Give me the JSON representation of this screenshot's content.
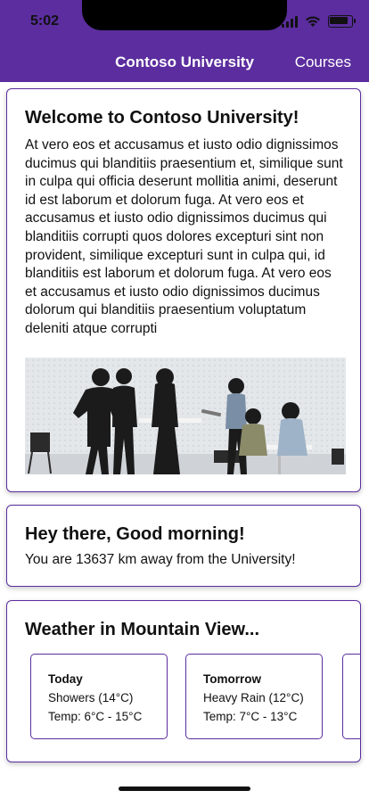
{
  "status_bar": {
    "time": "5:02"
  },
  "nav": {
    "title": "Contoso University",
    "link": "Courses"
  },
  "welcome": {
    "title": "Welcome to Contoso University!",
    "text": "At vero eos et accusamus et iusto odio dignissimos ducimus qui blanditiis praesentium et, similique sunt in culpa qui officia deserunt mollitia animi, deserunt id est laborum et dolorum fuga. At vero eos et accusamus et iusto odio dignissimos ducimus qui blanditiis corrupti quos dolores excepturi sint non provident, similique excepturi sunt in culpa qui, id blanditiis est laborum et dolorum fuga. At vero eos et accusamus et iusto odio dignissimos ducimus dolorum qui blanditiis praesentium voluptatum deleniti atque corrupti"
  },
  "greeting": {
    "title": "Hey there, Good morning!",
    "distance_text": "You are 13637 km away from the University!"
  },
  "weather": {
    "title": "Weather in Mountain View...",
    "days": [
      {
        "day": "Today",
        "condition": "Showers (14°C)",
        "temp": "Temp: 6°C - 15°C"
      },
      {
        "day": "Tomorrow",
        "condition": "Heavy Rain (12°C)",
        "temp": "Temp: 7°C - 13°C"
      }
    ]
  },
  "colors": {
    "brand": "#5b2d9e"
  }
}
